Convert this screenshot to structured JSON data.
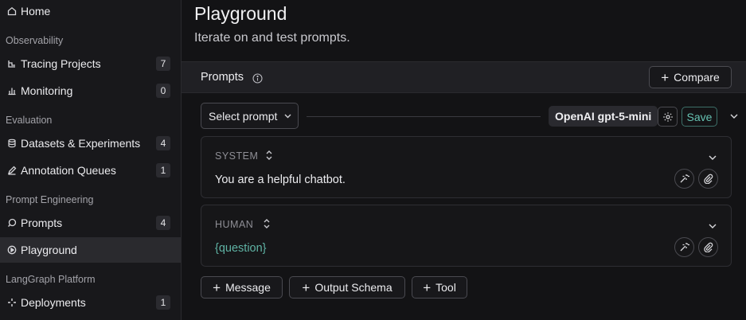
{
  "sidebar": {
    "items": [
      {
        "label": "Home",
        "icon": "home-icon"
      },
      {
        "label": "Tracing Projects",
        "icon": "tracing-icon",
        "count": "7"
      },
      {
        "label": "Monitoring",
        "icon": "monitoring-icon",
        "count": "0"
      },
      {
        "label": "Datasets & Experiments",
        "icon": "database-icon",
        "count": "4"
      },
      {
        "label": "Annotation Queues",
        "icon": "pen-icon",
        "count": "1"
      },
      {
        "label": "Prompts",
        "icon": "prompt-icon",
        "count": "4"
      },
      {
        "label": "Playground",
        "icon": "play-icon",
        "active": true
      },
      {
        "label": "Deployments",
        "icon": "deploy-icon",
        "count": "1"
      }
    ],
    "sections": [
      "Observability",
      "Evaluation",
      "Prompt Engineering",
      "LangGraph Platform"
    ]
  },
  "page": {
    "title": "Playground",
    "subtitle": "Iterate on and test prompts."
  },
  "prompts_bar": {
    "title": "Prompts",
    "compare_label": "Compare"
  },
  "toolbar": {
    "select_prompt": "Select prompt",
    "model": "OpenAI gpt-5-mini",
    "save_label": "Save"
  },
  "messages": [
    {
      "role": "SYSTEM",
      "text": "You are a helpful chatbot."
    },
    {
      "role": "HUMAN",
      "text": "{question}"
    }
  ],
  "add_buttons": {
    "message": "Message",
    "output_schema": "Output Schema",
    "tool": "Tool"
  },
  "colors": {
    "accent": "#66c2b2",
    "background": "#131315",
    "sidebar": "#18181b"
  }
}
